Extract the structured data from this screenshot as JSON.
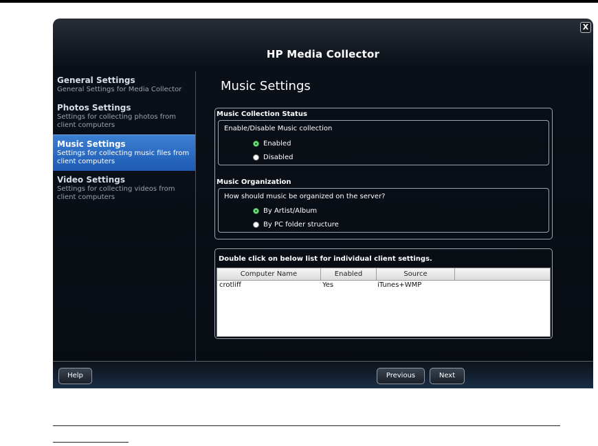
{
  "app": {
    "title": "HP Media Collector",
    "close_glyph": "X"
  },
  "sidebar": {
    "items": [
      {
        "title": "General Settings",
        "desc": "General Settings for Media Collector"
      },
      {
        "title": "Photos Settings",
        "desc": "Settings for collecting photos from client computers"
      },
      {
        "title": "Music Settings",
        "desc": "Settings for collecting music files from client computers"
      },
      {
        "title": "Video Settings",
        "desc": "Settings for collecting videos from client computers"
      }
    ],
    "active_index": 2
  },
  "main": {
    "page_title": "Music Settings",
    "collection": {
      "header": "Music Collection Status",
      "question": "Enable/Disable Music collection",
      "options": [
        "Enabled",
        "Disabled"
      ],
      "selected": "Enabled"
    },
    "organization": {
      "header": "Music Organization",
      "question": "How should music be organized on the server?",
      "options": [
        "By Artist/Album",
        "By PC folder structure"
      ],
      "selected": "By Artist/Album"
    },
    "clients": {
      "header": "Double click on below list for individual client settings.",
      "columns": [
        "Computer Name",
        "Enabled",
        "Source",
        ""
      ],
      "rows": [
        {
          "name": "crotliff",
          "enabled": "Yes",
          "source": "iTunes+WMP"
        }
      ]
    }
  },
  "footer": {
    "help": "Help",
    "previous": "Previous",
    "next": "Next"
  }
}
